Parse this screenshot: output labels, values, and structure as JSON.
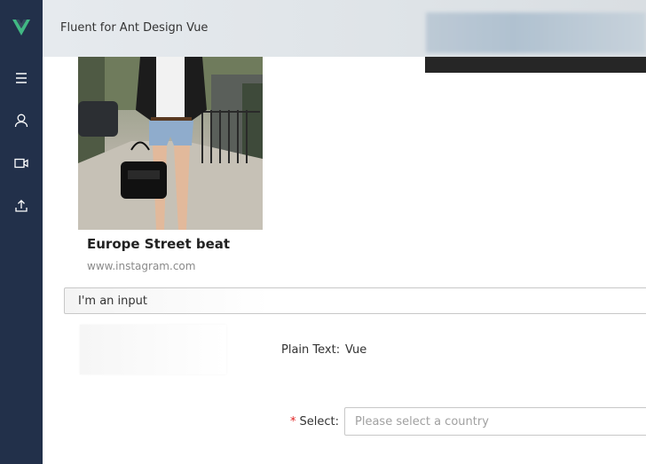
{
  "app": {
    "title": "Fluent for Ant Design Vue",
    "logo_icon": "vue-logo-icon",
    "accent": "#41b883"
  },
  "sidebar": {
    "items": [
      {
        "icon": "menu-icon"
      },
      {
        "icon": "user-icon"
      },
      {
        "icon": "video-camera-icon"
      },
      {
        "icon": "upload-icon"
      }
    ]
  },
  "card": {
    "title": "Europe Street beat",
    "description": "www.instagram.com"
  },
  "input": {
    "value": "I'm an input"
  },
  "form": {
    "plain_text_label": "Plain Text",
    "plain_text_value": "Vue",
    "select_label": "Select",
    "select_required_mark": "*",
    "select_placeholder": "Please select a country",
    "label_colon": ":"
  }
}
